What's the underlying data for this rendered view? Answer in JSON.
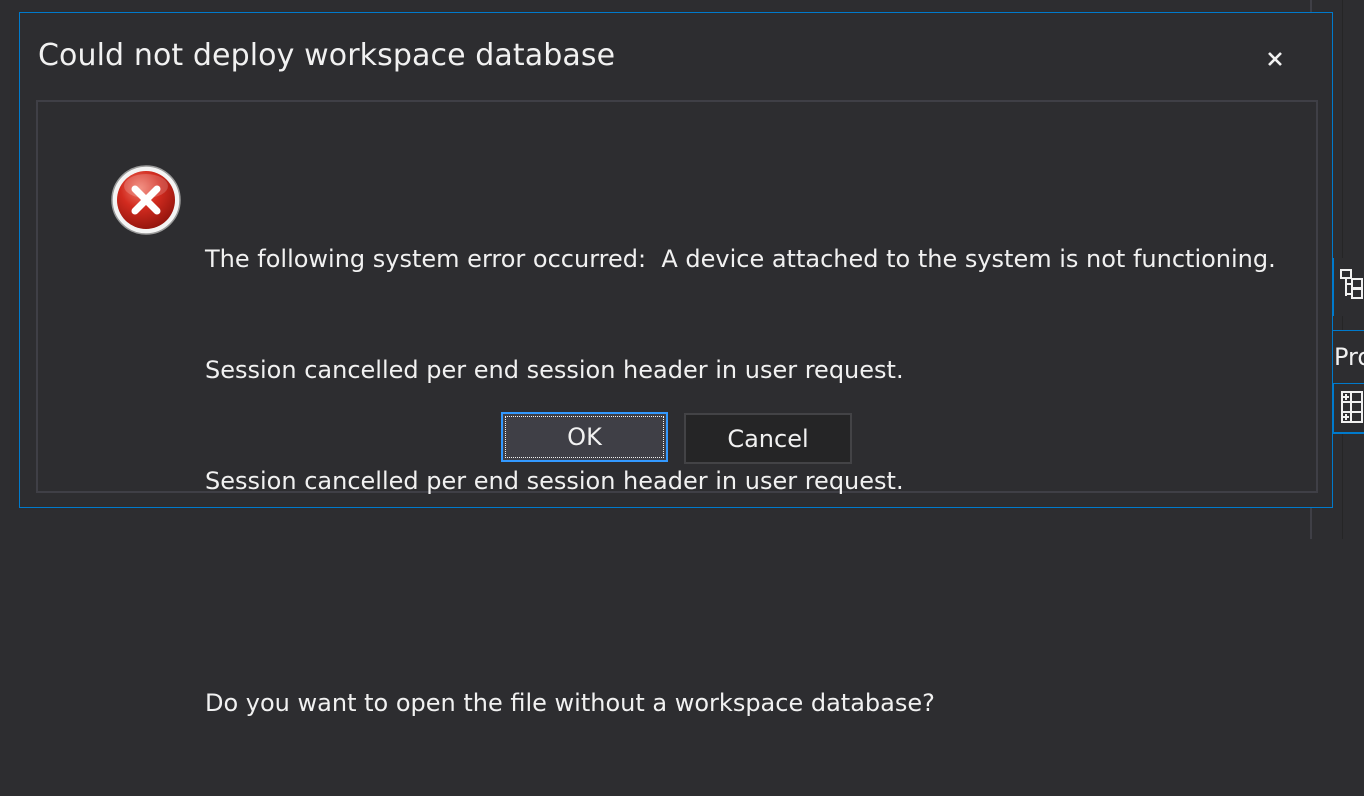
{
  "dialog": {
    "title": "Could not deploy workspace database",
    "close_glyph": "×",
    "message_lines": [
      "The following system error occurred:  A device attached to the system is not functioning.",
      "Session cancelled per end session header in user request.",
      "Session cancelled per end session header in user request.",
      "",
      "Do you want to open the file without a workspace database?"
    ],
    "icon": "error-icon",
    "buttons": {
      "ok_label": "OK",
      "cancel_label": "Cancel"
    }
  },
  "background": {
    "side_tab_text": "Pro",
    "icons": [
      "tree-icon",
      "grid-icon"
    ]
  },
  "colors": {
    "accent": "#007acc",
    "dialog_bg": "#2d2d30",
    "error_red": "#c42b1c",
    "text": "#f1f1f1"
  }
}
